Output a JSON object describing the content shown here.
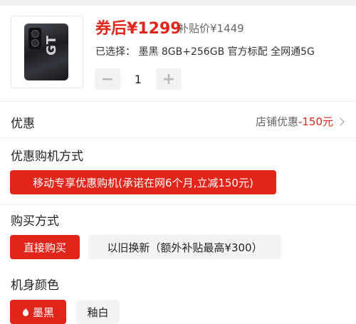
{
  "product": {
    "price_label": "券后",
    "price": "¥1299",
    "original_price": "补贴价¥1449",
    "selected_label": "已选择：",
    "selected_value": "墨黑 8GB+256GB 官方标配 全网通5G",
    "quantity": "1",
    "thumb_icon": "phone-image",
    "thumb_badge_text": "GT"
  },
  "coupon_row": {
    "label": "优惠",
    "detail_prefix": "店铺优惠",
    "detail_amount": "-150元"
  },
  "purchase_method": {
    "title": "优惠购机方式",
    "option": "移动专享优惠购机(承诺在网6个月,立减150元)"
  },
  "buy_type": {
    "title": "购买方式",
    "options": [
      "直接购买",
      "以旧换新（额外补贴最高¥300）"
    ],
    "selected": "直接购买"
  },
  "color": {
    "title": "机身颜色",
    "options": [
      "墨黑",
      "釉白"
    ],
    "selected": "墨黑"
  },
  "colors": {
    "accent": "#e1251b",
    "chip_gray": "#f3f3f3"
  }
}
